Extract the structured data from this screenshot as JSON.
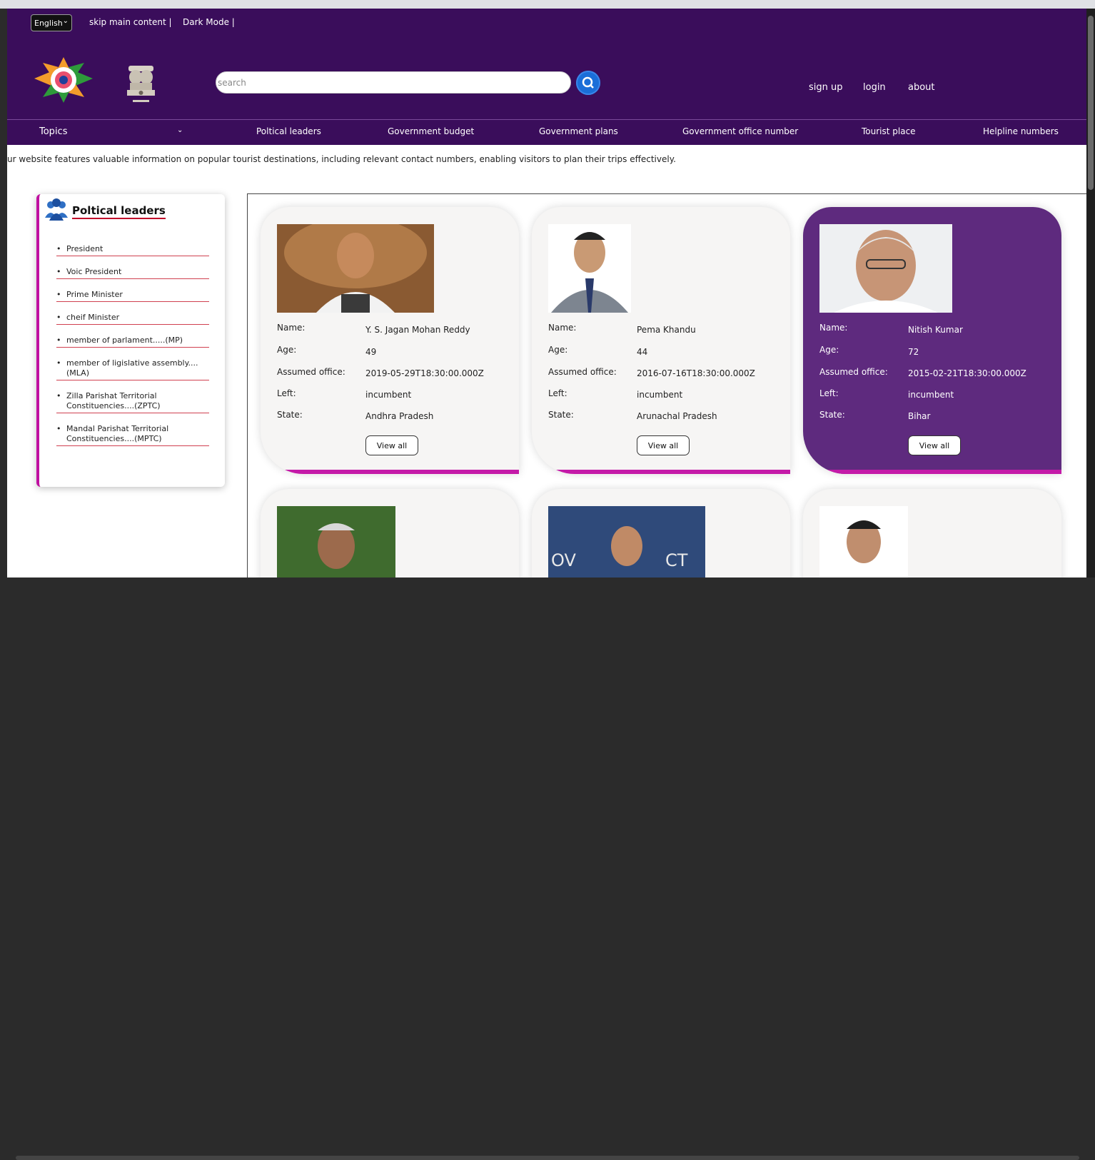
{
  "header": {
    "language": "English",
    "skip_link": "skip main content |",
    "dark_mode": "Dark Mode |",
    "search_placeholder": "search",
    "nav_right": [
      "sign up",
      "login",
      "about"
    ]
  },
  "navbar": {
    "topics": "Topics",
    "items": [
      "Poltical leaders",
      "Government budget",
      "Government plans",
      "Government office number",
      "Tourist place",
      "Helpline numbers"
    ]
  },
  "marquee": "ur website features valuable information on popular tourist destinations, including relevant contact numbers, enabling visitors to plan their trips effectively.",
  "sidebar": {
    "title": "Poltical leaders",
    "items": [
      "President",
      "Voic President",
      "Prime Minister",
      "cheif Minister",
      "member of parlament.....(MP)",
      "member of ligislative assembly....(MLA)",
      "Zilla Parishat Territorial Constituencies....(ZPTC)",
      "Mandal Parishat Territorial Constituencies....(MPTC)"
    ]
  },
  "cards": {
    "labels": {
      "name": "Name:",
      "age": "Age:",
      "assumed": "Assumed office:",
      "left": "Left:",
      "state": "State:"
    },
    "button": "View all",
    "items": [
      {
        "name": "Y. S. Jagan Mohan Reddy",
        "age": "49",
        "assumed": "2019-05-29T18:30:00.000Z",
        "left": "incumbent",
        "state": "Andhra Pradesh"
      },
      {
        "name": "Pema Khandu",
        "age": "44",
        "assumed": "2016-07-16T18:30:00.000Z",
        "left": "incumbent",
        "state": "Arunachal Pradesh"
      },
      {
        "name": "Nitish Kumar",
        "age": "72",
        "assumed": "2015-02-21T18:30:00.000Z",
        "left": "incumbent",
        "state": "Bihar"
      }
    ]
  },
  "colors": {
    "header": "#3a0d5b",
    "accent": "#c41aa8",
    "highlight_card": "#5e2a7e"
  }
}
